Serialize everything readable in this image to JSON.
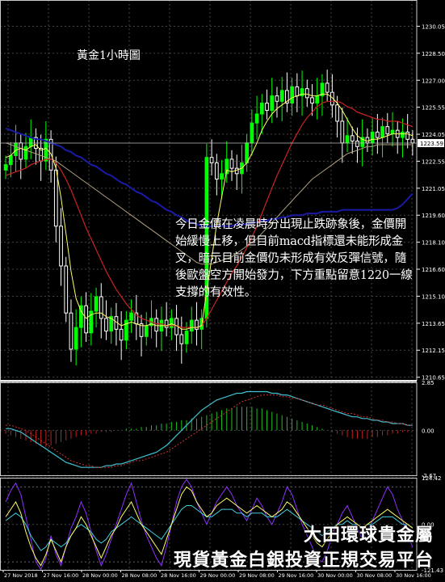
{
  "title": "黃金1小時圖",
  "commentary": "今日金價在凌晨時分出現止跌跡象後，金價開始緩慢上移，但目前macd指標還未能形成金叉，暗示目前金價仍未形成有效反彈信號，隨後歐盤空方開始發力，下方重點留意1220一線支撐的有效性。",
  "brand": {
    "line1": "大田環球貴金屬",
    "line2": "現貨黃金白銀投資正規交易平台"
  },
  "colors": {
    "background": "#000000",
    "bull_candle": "#00ff00",
    "bear_candle": "#ffffff",
    "ma_fast": "#ffff66",
    "ma_mid": "#cc2222",
    "ma_slow": "#1a1aa8",
    "ma_long": "#b0a080",
    "macd_line": "#40c0d0",
    "macd_signal": "#d03030",
    "rsi_a": "#ffff66",
    "rsi_b": "#9030ff",
    "rsi_c": "#40d0e0"
  },
  "chart_data": [
    {
      "type": "candlestick",
      "title": "黃金1小時圖",
      "ylim": [
        1210.5,
        1231.5
      ],
      "y_ticks": [
        "1230.05",
        "1228.50",
        "1227.00",
        "1225.55",
        "1224.05",
        "1222.55",
        "1221.05",
        "1219.60",
        "1218.10",
        "1216.60",
        "1215.10",
        "1213.65",
        "1212.15",
        "1210.65"
      ],
      "current_price": "1223.59",
      "x_labels": [
        "27 Nov 2018",
        "27 Nov 16:00",
        "28 Nov 00:00",
        "28 Nov 08:00",
        "28 Nov 16:00",
        "29 Nov 00:00",
        "29 Nov 08:00",
        "29 Nov 16:00",
        "30 Nov 00:00",
        "30 Nov 08:00",
        "30 Nov 16:00"
      ],
      "close": [
        1222.4,
        1222.9,
        1223.6,
        1222.7,
        1223.4,
        1223.9,
        1223.3,
        1222.6,
        1223.8,
        1222.1,
        1219.0,
        1216.8,
        1214.2,
        1212.2,
        1213.4,
        1214.6,
        1213.1,
        1214.3,
        1215.1,
        1213.9,
        1213.2,
        1214.0,
        1213.3,
        1212.7,
        1213.8,
        1214.2,
        1213.6,
        1212.9,
        1213.5,
        1213.9,
        1213.2,
        1213.8,
        1213.4,
        1213.9,
        1213.0,
        1212.5,
        1213.2,
        1213.8,
        1213.3,
        1213.9,
        1222.8,
        1222.5,
        1221.6,
        1221.9,
        1222.7,
        1222.2,
        1221.9,
        1222.5,
        1223.6,
        1224.7,
        1225.2,
        1225.8,
        1225.4,
        1226.2,
        1225.9,
        1226.5,
        1225.8,
        1226.7,
        1226.2,
        1226.6,
        1226.1,
        1225.8,
        1226.2,
        1226.9,
        1226.4,
        1225.7,
        1224.8,
        1223.6,
        1224.0,
        1223.7,
        1223.4,
        1223.9,
        1223.6,
        1224.2,
        1223.9,
        1224.5,
        1224.1,
        1224.3,
        1223.9,
        1224.2,
        1223.8,
        1223.6
      ],
      "ma_fast": [
        1222.8,
        1222.9,
        1223.2,
        1223.3,
        1223.2,
        1223.4,
        1223.5,
        1223.2,
        1223.3,
        1223.0,
        1222.2,
        1220.6,
        1218.6,
        1216.5,
        1215.0,
        1214.3,
        1213.9,
        1214.1,
        1214.2,
        1214.2,
        1214.0,
        1213.9,
        1213.7,
        1213.5,
        1213.6,
        1213.7,
        1213.6,
        1213.5,
        1213.5,
        1213.6,
        1213.5,
        1213.5,
        1213.5,
        1213.6,
        1213.5,
        1213.3,
        1213.3,
        1213.4,
        1213.4,
        1213.5,
        1215.4,
        1217.2,
        1219.1,
        1220.6,
        1222.1,
        1222.0,
        1222.1,
        1222.2,
        1222.5,
        1223.0,
        1223.6,
        1224.3,
        1224.8,
        1225.2,
        1225.5,
        1225.7,
        1225.9,
        1226.1,
        1226.2,
        1226.3,
        1226.3,
        1226.2,
        1226.2,
        1226.3,
        1226.3,
        1226.1,
        1225.8,
        1225.4,
        1224.9,
        1224.4,
        1224.0,
        1223.8,
        1223.7,
        1223.8,
        1223.8,
        1223.9,
        1224.0,
        1224.1,
        1224.1,
        1224.1,
        1224.1,
        1224.0
      ],
      "ma_mid": [
        1221.8,
        1221.9,
        1222.0,
        1222.1,
        1222.2,
        1222.4,
        1222.5,
        1222.6,
        1222.7,
        1222.7,
        1222.5,
        1222.1,
        1221.6,
        1221.0,
        1220.3,
        1219.6,
        1218.9,
        1218.3,
        1217.7,
        1217.1,
        1216.5,
        1216.0,
        1215.5,
        1215.1,
        1214.7,
        1214.4,
        1214.1,
        1213.9,
        1213.8,
        1213.7,
        1213.6,
        1213.6,
        1213.5,
        1213.5,
        1213.5,
        1213.4,
        1213.4,
        1213.4,
        1213.4,
        1213.5,
        1213.9,
        1214.4,
        1214.9,
        1215.4,
        1215.9,
        1216.4,
        1216.8,
        1217.3,
        1217.8,
        1218.4,
        1219.0,
        1219.7,
        1220.4,
        1221.1,
        1221.8,
        1222.4,
        1223.0,
        1223.6,
        1224.1,
        1224.6,
        1225.0,
        1225.3,
        1225.6,
        1225.8,
        1225.9,
        1225.9,
        1225.9,
        1225.8,
        1225.6,
        1225.5,
        1225.3,
        1225.2,
        1225.1,
        1225.0,
        1224.9,
        1224.9,
        1224.8,
        1224.8,
        1224.8,
        1224.7,
        1224.6,
        1224.5
      ],
      "ma_slow": [
        1224.4,
        1224.3,
        1224.2,
        1224.1,
        1224.0,
        1223.9,
        1223.8,
        1223.8,
        1223.7,
        1223.6,
        1223.5,
        1223.4,
        1223.2,
        1223.1,
        1222.9,
        1222.8,
        1222.6,
        1222.4,
        1222.3,
        1222.1,
        1221.9,
        1221.8,
        1221.6,
        1221.4,
        1221.3,
        1221.1,
        1220.9,
        1220.8,
        1220.6,
        1220.4,
        1220.3,
        1220.1,
        1219.9,
        1219.8,
        1219.6,
        1219.5,
        1219.3,
        1219.2,
        1219.1,
        1219.0,
        1219.0,
        1219.0,
        1219.0,
        1219.0,
        1219.0,
        1219.0,
        1219.1,
        1219.1,
        1219.1,
        1219.2,
        1219.2,
        1219.3,
        1219.3,
        1219.4,
        1219.4,
        1219.5,
        1219.5,
        1219.6,
        1219.6,
        1219.6,
        1219.7,
        1219.7,
        1219.7,
        1219.8,
        1219.8,
        1219.8,
        1219.8,
        1219.9,
        1219.9,
        1219.9,
        1219.9,
        1219.9,
        1219.9,
        1219.9,
        1219.9,
        1219.9,
        1219.9,
        1219.9,
        1220.0,
        1220.2,
        1220.5,
        1220.8
      ],
      "ma_long": [
        1223.6,
        1223.5,
        1223.4,
        1223.3,
        1223.2,
        1223.1,
        1223.0,
        1222.9,
        1222.8,
        1222.7,
        1222.6,
        1222.4,
        1222.2,
        1222.0,
        1221.8,
        1221.6,
        1221.4,
        1221.2,
        1221.0,
        1220.8,
        1220.6,
        1220.4,
        1220.2,
        1220.0,
        1219.8,
        1219.6,
        1219.4,
        1219.2,
        1219.0,
        1218.8,
        1218.6,
        1218.4,
        1218.2,
        1218.0,
        1217.8,
        1217.6,
        1217.4,
        1217.2,
        1217.0,
        1216.9,
        1216.9,
        1216.9,
        1217.0,
        1217.1,
        1217.2,
        1217.3,
        1217.5,
        1217.7,
        1217.9,
        1218.1,
        1218.3,
        1218.6,
        1218.9,
        1219.2,
        1219.5,
        1219.8,
        1220.1,
        1220.4,
        1220.7,
        1221.0,
        1221.3,
        1221.6,
        1221.8,
        1222.0,
        1222.2,
        1222.4,
        1222.6,
        1222.8,
        1223.0,
        1223.1,
        1223.2,
        1223.3,
        1223.4,
        1223.4,
        1223.5,
        1223.5,
        1223.5,
        1223.5,
        1223.5,
        1223.5,
        1223.5,
        1223.5
      ]
    },
    {
      "type": "macd",
      "y_ticks": [
        "2.85",
        "0.00",
        "-2.67"
      ],
      "ylim": [
        -2.67,
        2.85
      ],
      "hist": [
        -0.2,
        -0.3,
        -0.4,
        -0.5,
        -0.6,
        -0.7,
        -0.8,
        -0.9,
        -1.0,
        -0.9,
        -0.8,
        -0.7,
        -0.6,
        -0.5,
        -0.4,
        -0.3,
        -0.3,
        -0.2,
        -0.2,
        -0.1,
        -0.1,
        -0.1,
        0.0,
        0.0,
        0.1,
        0.1,
        0.1,
        0.2,
        0.2,
        0.3,
        0.3,
        0.4,
        0.4,
        0.5,
        0.5,
        0.6,
        0.6,
        0.7,
        0.7,
        0.8,
        0.9,
        1.0,
        1.1,
        1.2,
        1.3,
        1.3,
        1.4,
        1.4,
        1.4,
        1.4,
        1.3,
        1.3,
        1.2,
        1.1,
        1.0,
        0.9,
        0.8,
        0.7,
        0.6,
        0.5,
        0.4,
        0.3,
        0.2,
        0.1,
        0.0,
        -0.1,
        -0.2,
        -0.3,
        -0.4,
        -0.5,
        -0.5,
        -0.5,
        -0.5,
        -0.4,
        -0.4,
        -0.3,
        -0.3,
        -0.2,
        -0.2,
        -0.1,
        -0.1,
        0.0
      ],
      "macd": [
        0.1,
        0.1,
        0.0,
        -0.1,
        -0.3,
        -0.5,
        -0.7,
        -0.9,
        -1.1,
        -1.3,
        -1.5,
        -1.7,
        -1.9,
        -2.0,
        -2.1,
        -2.2,
        -2.2,
        -2.2,
        -2.2,
        -2.2,
        -2.1,
        -2.1,
        -2.0,
        -2.0,
        -1.9,
        -1.8,
        -1.7,
        -1.6,
        -1.5,
        -1.4,
        -1.3,
        -1.1,
        -0.9,
        -0.6,
        -0.3,
        0.0,
        0.3,
        0.6,
        0.9,
        1.2,
        1.4,
        1.6,
        1.8,
        1.9,
        2.0,
        2.1,
        2.2,
        2.2,
        2.3,
        2.3,
        2.3,
        2.3,
        2.3,
        2.2,
        2.2,
        2.1,
        2.1,
        2.0,
        1.9,
        1.8,
        1.7,
        1.6,
        1.5,
        1.4,
        1.3,
        1.2,
        1.1,
        1.0,
        0.9,
        0.8,
        0.8,
        0.7,
        0.7,
        0.6,
        0.6,
        0.5,
        0.5,
        0.4,
        0.4,
        0.4,
        0.3,
        0.3
      ],
      "signal": [
        0.3,
        0.3,
        0.2,
        0.1,
        0.0,
        -0.2,
        -0.4,
        -0.6,
        -0.8,
        -1.0,
        -1.2,
        -1.4,
        -1.6,
        -1.8,
        -1.9,
        -2.0,
        -2.1,
        -2.1,
        -2.2,
        -2.2,
        -2.2,
        -2.2,
        -2.1,
        -2.1,
        -2.0,
        -1.9,
        -1.8,
        -1.8,
        -1.7,
        -1.6,
        -1.5,
        -1.4,
        -1.3,
        -1.1,
        -0.9,
        -0.7,
        -0.5,
        -0.3,
        -0.1,
        0.1,
        0.3,
        0.5,
        0.7,
        0.9,
        1.1,
        1.3,
        1.5,
        1.7,
        1.8,
        1.9,
        2.0,
        2.1,
        2.1,
        2.1,
        2.1,
        2.0,
        2.0,
        1.9,
        1.9,
        1.8,
        1.7,
        1.6,
        1.5,
        1.5,
        1.4,
        1.3,
        1.2,
        1.1,
        1.0,
        1.0,
        0.9,
        0.8,
        0.8,
        0.7,
        0.6,
        0.6,
        0.5,
        0.5,
        0.4,
        0.4,
        0.3,
        0.3
      ]
    },
    {
      "type": "line",
      "y_ticks": [
        "124.42",
        "0.00",
        "-121.43"
      ],
      "ylim": [
        -121.43,
        124.42
      ],
      "series_a": [
        20,
        40,
        60,
        30,
        -20,
        -60,
        -90,
        -110,
        -80,
        -40,
        -70,
        -100,
        -60,
        -30,
        -10,
        20,
        0,
        -30,
        -60,
        -90,
        -60,
        -30,
        -10,
        20,
        40,
        60,
        30,
        0,
        -20,
        -40,
        -60,
        -80,
        -40,
        0,
        40,
        80,
        100,
        90,
        60,
        40,
        20,
        30,
        50,
        60,
        70,
        60,
        50,
        40,
        30,
        40,
        50,
        40,
        30,
        20,
        30,
        40,
        60,
        50,
        30,
        10,
        -10,
        -30,
        -50,
        -60,
        -40,
        -20,
        0,
        10,
        20,
        10,
        0,
        -10,
        0,
        10,
        20,
        30,
        40,
        30,
        20,
        10,
        0,
        -10
      ],
      "series_b": [
        60,
        90,
        110,
        80,
        20,
        -40,
        -100,
        -120,
        -90,
        -30,
        -80,
        -110,
        -60,
        -10,
        20,
        60,
        30,
        -20,
        -70,
        -110,
        -80,
        -40,
        0,
        40,
        80,
        110,
        60,
        10,
        -30,
        -60,
        -90,
        -110,
        -60,
        0,
        60,
        100,
        120,
        100,
        60,
        30,
        0,
        30,
        60,
        80,
        100,
        80,
        50,
        30,
        10,
        40,
        70,
        50,
        20,
        0,
        30,
        60,
        100,
        80,
        40,
        0,
        -30,
        -60,
        -90,
        -100,
        -70,
        -30,
        0,
        30,
        50,
        20,
        -10,
        -40,
        -20,
        10,
        40,
        70,
        100,
        80,
        40,
        10,
        -30,
        -60
      ],
      "series_c": [
        10,
        20,
        30,
        20,
        0,
        -30,
        -50,
        -70,
        -60,
        -40,
        -50,
        -60,
        -50,
        -30,
        -10,
        0,
        -10,
        -20,
        -40,
        -50,
        -40,
        -20,
        -10,
        0,
        10,
        20,
        10,
        0,
        -10,
        -20,
        -30,
        -40,
        -20,
        0,
        20,
        40,
        50,
        50,
        40,
        30,
        20,
        20,
        30,
        40,
        40,
        40,
        30,
        30,
        20,
        30,
        30,
        30,
        20,
        20,
        20,
        30,
        40,
        30,
        20,
        10,
        0,
        -10,
        -20,
        -30,
        -20,
        -10,
        0,
        0,
        10,
        0,
        0,
        -10,
        0,
        0,
        10,
        20,
        20,
        20,
        10,
        0,
        0,
        -10
      ]
    }
  ]
}
